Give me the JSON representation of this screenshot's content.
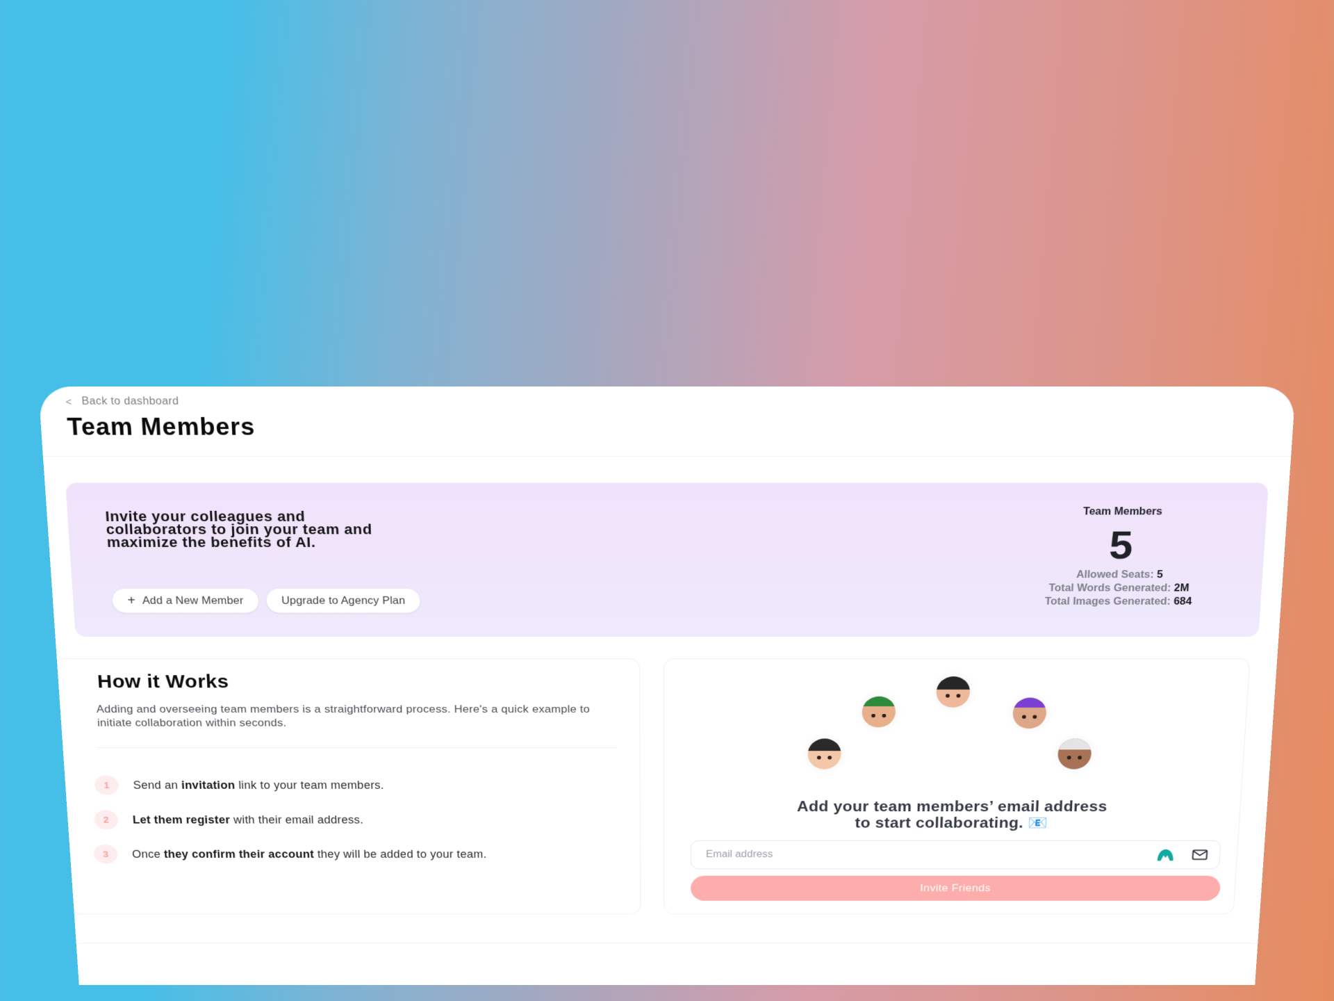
{
  "header": {
    "back_label": "Back to dashboard",
    "title": "Team Members"
  },
  "hero": {
    "lines": [
      "Invite your colleagues and",
      "collaborators to join your team and",
      "maximize the benefits of AI."
    ],
    "add_member_label": "Add a New Member",
    "upgrade_label": "Upgrade to Agency Plan"
  },
  "stats": {
    "title": "Team Members",
    "count": "5",
    "allowed_seats_label": "Allowed Seats:",
    "allowed_seats_value": "5",
    "words_label": "Total Words Generated:",
    "words_value": "2M",
    "images_label": "Total Images Generated:",
    "images_value": "684"
  },
  "how_it_works": {
    "title": "How it Works",
    "description": "Adding and overseeing team members is a straightforward process. Here's a quick example to initiate collaboration within seconds.",
    "steps": [
      {
        "num": "1",
        "pre": "Send an ",
        "bold": "invitation",
        "post": " link to your team members."
      },
      {
        "num": "2",
        "pre": "",
        "bold": "Let them register",
        "post": " with their email address."
      },
      {
        "num": "3",
        "pre": "Once ",
        "bold": "they confirm their account",
        "post": " they will be added to your team."
      }
    ]
  },
  "invite": {
    "avatars": [
      "avatar-woman-glasses",
      "avatar-man-green-cap",
      "avatar-person-dark-hair",
      "avatar-man-purple-cap",
      "avatar-older-man-glasses"
    ],
    "cta_line1": "Add your team members’ email address",
    "cta_line2": "to start collaborating. 📧",
    "email_placeholder": "Email address",
    "email_value": "",
    "button_label": "Invite Friends"
  },
  "colors": {
    "accent_pink": "#FEADAD",
    "hero_bg": "#F1E2FB",
    "step_badge_bg": "#FEEDEE",
    "step_badge_text": "#F9A3A5",
    "gradient_start": "#45BFE8",
    "gradient_mid": "#D59CA9",
    "gradient_end": "#E68B5E"
  }
}
